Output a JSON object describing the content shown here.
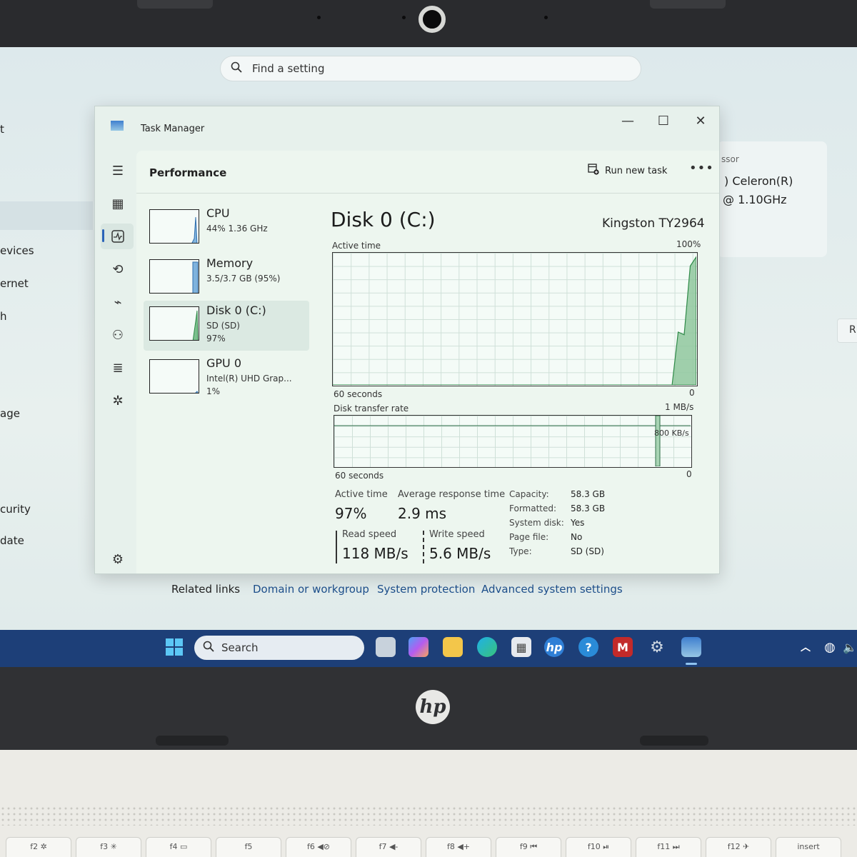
{
  "settings": {
    "search_placeholder": "Find a setting",
    "nav_fragments": [
      "t",
      "evices",
      "ernet",
      "h",
      "age",
      "curity",
      "date"
    ],
    "processor_label": "ssor",
    "processor_line1": ") Celeron(R)",
    "processor_line2": "@ 1.10GHz",
    "right_button": "R",
    "related_links": {
      "label": "Related links",
      "links": [
        "Domain or workgroup",
        "System protection",
        "Advanced system settings"
      ]
    }
  },
  "task_manager": {
    "title": "Task Manager",
    "window_buttons": {
      "minimize": "—",
      "maximize": "☐",
      "close": "✕"
    },
    "page_title": "Performance",
    "run_new_task": "Run new task",
    "more": "•••",
    "resources": [
      {
        "name": "CPU",
        "sub1": "44%  1.36 GHz",
        "sub2": "",
        "level": 0.44
      },
      {
        "name": "Memory",
        "sub1": "3.5/3.7 GB (95%)",
        "sub2": "",
        "level": 0.95
      },
      {
        "name": "Disk 0 (C:)",
        "sub1": "SD (SD)",
        "sub2": "97%",
        "level": 0.97
      },
      {
        "name": "GPU 0",
        "sub1": "Intel(R) UHD Grap...",
        "sub2": "1%",
        "level": 0.01
      }
    ],
    "detail": {
      "title": "Disk 0 (C:)",
      "model": "Kingston TY2964",
      "active_time_graph": {
        "label": "Active time",
        "max": "100%",
        "x_left": "60 seconds",
        "x_right": "0"
      },
      "transfer_graph": {
        "label": "Disk transfer rate",
        "max": "1 MB/s",
        "mid": "800 KB/s",
        "x_left": "60 seconds",
        "x_right": "0"
      },
      "stats": {
        "active_time_label": "Active time",
        "active_time": "97%",
        "avg_response_label": "Average response time",
        "avg_response": "2.9 ms",
        "read_label": "Read speed",
        "read": "118 MB/s",
        "write_label": "Write speed",
        "write": "5.6 MB/s"
      },
      "props": [
        {
          "k": "Capacity:",
          "v": "58.3 GB"
        },
        {
          "k": "Formatted:",
          "v": "58.3 GB"
        },
        {
          "k": "System disk:",
          "v": "Yes"
        },
        {
          "k": "Page file:",
          "v": "No"
        },
        {
          "k": "Type:",
          "v": "SD (SD)"
        }
      ]
    }
  },
  "taskbar": {
    "search_placeholder": "Search"
  },
  "laptop": {
    "logo": "hp",
    "fkeys": [
      "f2 ✲",
      "f3 ✳",
      "f4 ▭",
      "f5",
      "f6 ◀⊘",
      "f7 ◀-",
      "f8 ◀+",
      "f9 ⏮",
      "f10 ⏯",
      "f11 ⏭",
      "f12 ✈",
      "insert"
    ]
  },
  "chart_data": [
    {
      "type": "area",
      "title": "Active time",
      "ylim": [
        0,
        100
      ],
      "x": [
        60,
        4,
        3,
        2,
        1,
        0
      ],
      "values": [
        0,
        0,
        40,
        38,
        90,
        97
      ]
    },
    {
      "type": "line",
      "title": "Disk transfer rate",
      "series": [
        {
          "values": [
            0,
            0,
            0,
            0,
            0,
            0
          ]
        }
      ]
    }
  ]
}
